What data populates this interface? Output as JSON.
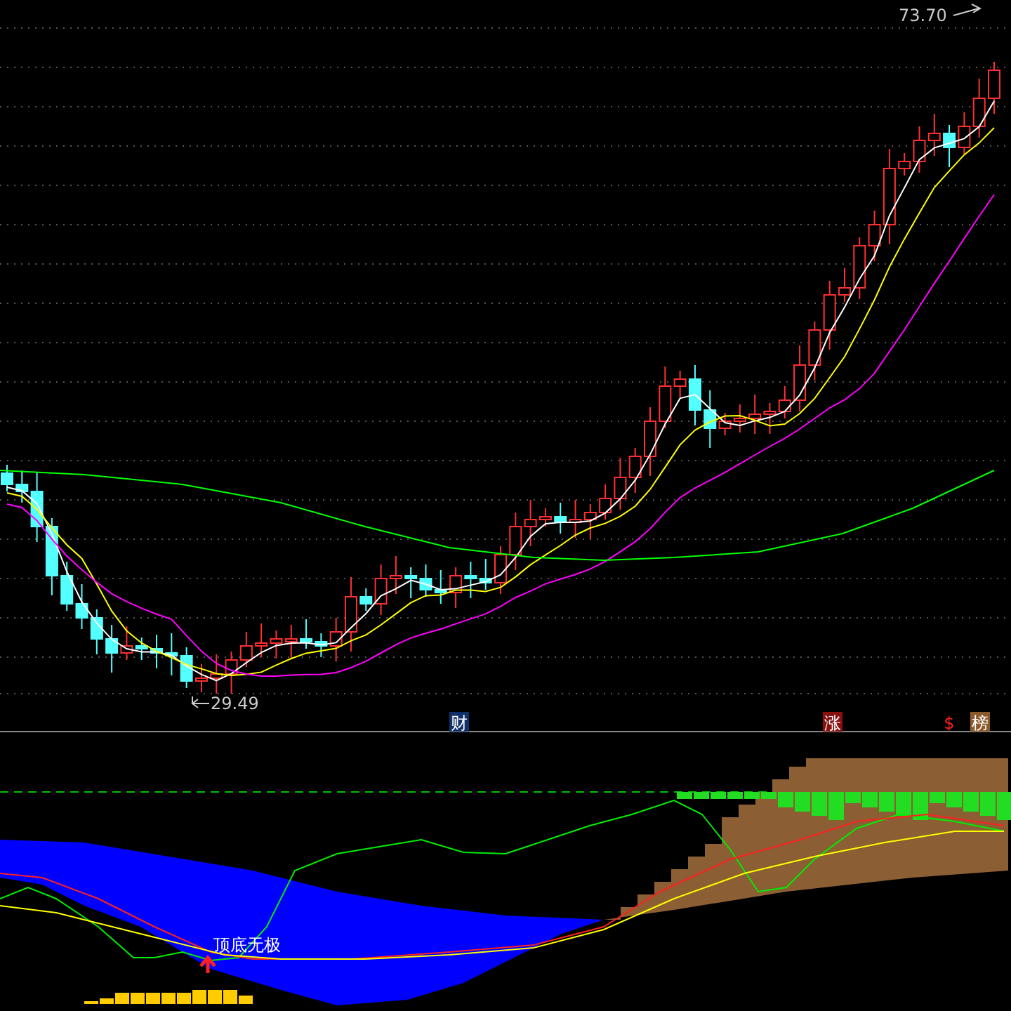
{
  "price_panel": {
    "high_label": "73.70",
    "low_label": "29.49",
    "event_markers": [
      {
        "kind": "finance",
        "label": "财"
      },
      {
        "kind": "rise",
        "label": "涨"
      },
      {
        "kind": "dollar",
        "label": "$"
      },
      {
        "kind": "rank",
        "label": "榜"
      }
    ]
  },
  "indicator_panel": {
    "signal_label": "顶底无极"
  }
}
